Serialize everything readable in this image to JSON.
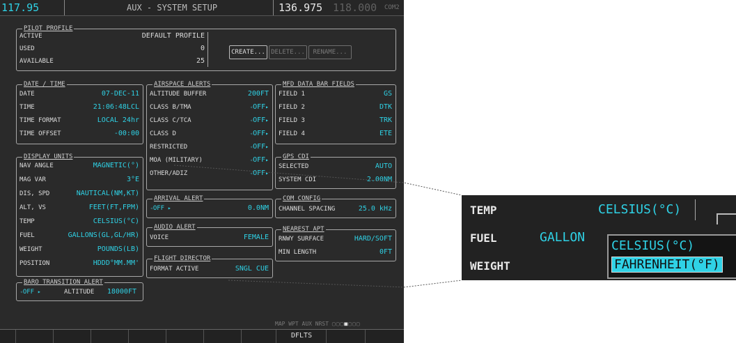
{
  "header": {
    "left_freq": "117.95",
    "page_title": "AUX - SYSTEM SETUP",
    "com_active": "136.975",
    "com_standby": "118.000",
    "com_label": "COM2"
  },
  "pilot_profile": {
    "title": "PILOT PROFILE",
    "active_label": "ACTIVE",
    "active_value": "DEFAULT PROFILE",
    "used_label": "USED",
    "used_value": "0",
    "available_label": "AVAILABLE",
    "available_value": "25",
    "create_label": "CREATE...",
    "delete_label": "DELETE...",
    "rename_label": "RENAME..."
  },
  "date_time": {
    "title": "DATE / TIME",
    "rows": [
      {
        "label": "DATE",
        "value": "07-DEC-11"
      },
      {
        "label": "TIME",
        "value": "21:06:48LCL"
      },
      {
        "label": "TIME FORMAT",
        "value": "LOCAL 24hr"
      },
      {
        "label": "TIME OFFSET",
        "value": "-00:00"
      }
    ]
  },
  "display_units": {
    "title": "DISPLAY UNITS",
    "rows": [
      {
        "label": "NAV ANGLE",
        "value": "MAGNETIC(°)"
      },
      {
        "label": "MAG VAR",
        "value": "3°E"
      },
      {
        "label": "DIS, SPD",
        "value": "NAUTICAL(NM,KT)"
      },
      {
        "label": "ALT, VS",
        "value": "FEET(FT,FPM)"
      },
      {
        "label": "TEMP",
        "value": "CELSIUS(°C)"
      },
      {
        "label": "FUEL",
        "value": "GALLONS(GL,GL/HR)"
      },
      {
        "label": "WEIGHT",
        "value": "POUNDS(LB)"
      },
      {
        "label": "POSITION",
        "value": "HDDD°MM.MM'"
      }
    ]
  },
  "baro_transition": {
    "title": "BARO TRANSITION ALERT",
    "state": "OFF",
    "altitude_label": "ALTITUDE",
    "altitude_value": "18000FT"
  },
  "airspace_alerts": {
    "title": "AIRSPACE ALERTS",
    "buffer_label": "ALTITUDE BUFFER",
    "buffer_value": "200FT",
    "rows": [
      {
        "label": "CLASS B/TMA",
        "value": "OFF"
      },
      {
        "label": "CLASS C/TCA",
        "value": "OFF"
      },
      {
        "label": "CLASS D",
        "value": "OFF"
      },
      {
        "label": "RESTRICTED",
        "value": "OFF"
      },
      {
        "label": "MOA (MILITARY)",
        "value": "OFF"
      },
      {
        "label": "OTHER/ADIZ",
        "value": "OFF"
      }
    ]
  },
  "arrival_alert": {
    "title": "ARRIVAL ALERT",
    "state": "OFF",
    "distance": "0.0NM"
  },
  "audio_alert": {
    "title": "AUDIO ALERT",
    "label": "VOICE",
    "value": "FEMALE"
  },
  "flight_director": {
    "title": "FLIGHT DIRECTOR",
    "label": "FORMAT ACTIVE",
    "value": "SNGL CUE"
  },
  "mfd_fields": {
    "title": "MFD DATA BAR FIELDS",
    "rows": [
      {
        "label": "FIELD 1",
        "value": "GS"
      },
      {
        "label": "FIELD 2",
        "value": "DTK"
      },
      {
        "label": "FIELD 3",
        "value": "TRK"
      },
      {
        "label": "FIELD 4",
        "value": "ETE"
      }
    ]
  },
  "gps_cdi": {
    "title": "GPS CDI",
    "selected_label": "SELECTED",
    "selected_value": "AUTO",
    "system_label": "SYSTEM CDI",
    "system_value": "2.00NM"
  },
  "com_config": {
    "title": "COM CONFIG",
    "label": "CHANNEL SPACING",
    "value": "25.0 kHz"
  },
  "nearest_apt": {
    "title": "NEAREST APT",
    "surface_label": "RNWY SURFACE",
    "surface_value": "HARD/SOFT",
    "length_label": "MIN LENGTH",
    "length_value": "0FT"
  },
  "page_group": {
    "labels": "MAP WPT AUX NRST"
  },
  "softkeys": {
    "dflts": "DFLTS"
  },
  "zoom_callout": {
    "temp_label": "TEMP",
    "temp_value": "CELSIUS(°C)",
    "fuel_label": "FUEL",
    "fuel_value": "GALLON",
    "weight_label": "WEIGHT",
    "options": [
      "CELSIUS(°C)",
      "FAHRENHEIT(°F)"
    ],
    "selected_index": 1
  },
  "colors": {
    "cyan": "#2fd2e6",
    "label": "#dedede",
    "background": "#2a2a2a"
  }
}
